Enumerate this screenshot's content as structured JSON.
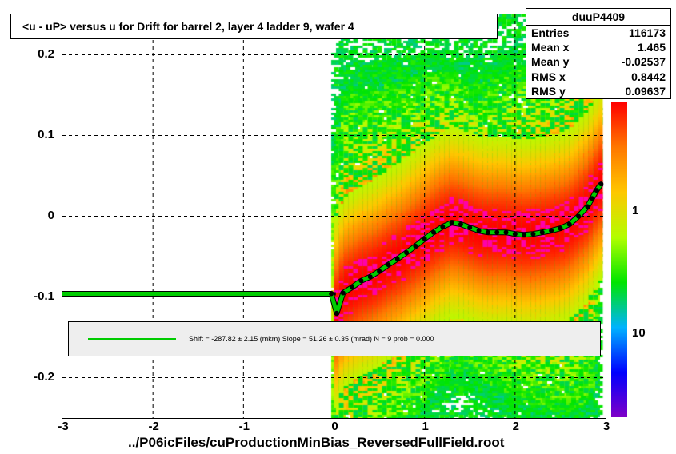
{
  "title": "<u - uP>       versus   u for Drift for barrel 2, layer 4 ladder 9, wafer 4",
  "stats": {
    "name": "duuP4409",
    "entries_label": "Entries",
    "entries": "116173",
    "meanx_label": "Mean x",
    "meanx": "1.465",
    "meany_label": "Mean y",
    "meany": "-0.02537",
    "rmsx_label": "RMS x",
    "rmsx": "0.8442",
    "rmsy_label": "RMS y",
    "rmsy": "0.09637"
  },
  "fit_legend": "Shift =  -287.82 ± 2.15 (mkm) Slope =    51.26 ± 0.35 (mrad)  N = 9 prob = 0.000",
  "xlabel": "../P06icFiles/cuProductionMinBias_ReversedFullField.root",
  "x_ticks": [
    "-3",
    "-2",
    "-1",
    "0",
    "1",
    "2",
    "3"
  ],
  "y_ticks": [
    "-0.2",
    "-0.1",
    "0",
    "0.1",
    "0.2"
  ],
  "colorbar_ticks": [
    "1",
    "10"
  ],
  "chart_data": {
    "type": "heatmap",
    "title": "<u - uP> versus u for Drift for barrel 2, layer 4 ladder 9, wafer 4",
    "xlabel": "../P06icFiles/cuProductionMinBias_ReversedFullField.root",
    "ylabel": "<u - uP>",
    "xlim": [
      -3,
      3
    ],
    "ylim": [
      -0.25,
      0.25
    ],
    "z_scale": "log",
    "zlim": [
      1,
      20
    ],
    "entries": 116173,
    "mean_x": 1.465,
    "mean_y": -0.02537,
    "rms_x": 0.8442,
    "rms_y": 0.09637,
    "dense_region_x": [
      0.0,
      3.0
    ],
    "fit": {
      "label": "Shift = -287.82 ± 2.15 (mkm), Slope = 51.26 ± 0.35 (mrad), N = 9, prob = 0.000",
      "shift_mkm": -287.82,
      "shift_err": 2.15,
      "slope_mrad": 51.26,
      "slope_err": 0.35,
      "N": 9,
      "prob": 0.0
    },
    "profile_series": {
      "name": "profile",
      "x": [
        -3.0,
        -0.03,
        0.03,
        0.1,
        0.2,
        0.3,
        0.4,
        0.5,
        0.6,
        0.7,
        0.8,
        0.9,
        1.0,
        1.1,
        1.2,
        1.3,
        1.4,
        1.5,
        1.6,
        1.7,
        1.8,
        1.9,
        2.0,
        2.1,
        2.2,
        2.3,
        2.4,
        2.5,
        2.6,
        2.7,
        2.8,
        2.85,
        2.9,
        2.95
      ],
      "y": [
        -0.096,
        -0.096,
        -0.12,
        -0.095,
        -0.088,
        -0.08,
        -0.075,
        -0.068,
        -0.06,
        -0.053,
        -0.045,
        -0.037,
        -0.028,
        -0.02,
        -0.013,
        -0.008,
        -0.01,
        -0.014,
        -0.018,
        -0.02,
        -0.02,
        -0.02,
        -0.022,
        -0.023,
        -0.022,
        -0.02,
        -0.018,
        -0.015,
        -0.01,
        0.0,
        0.012,
        0.022,
        0.032,
        0.04
      ]
    },
    "reference_line": {
      "y": -0.096,
      "x_range": [
        -3,
        0
      ]
    }
  }
}
